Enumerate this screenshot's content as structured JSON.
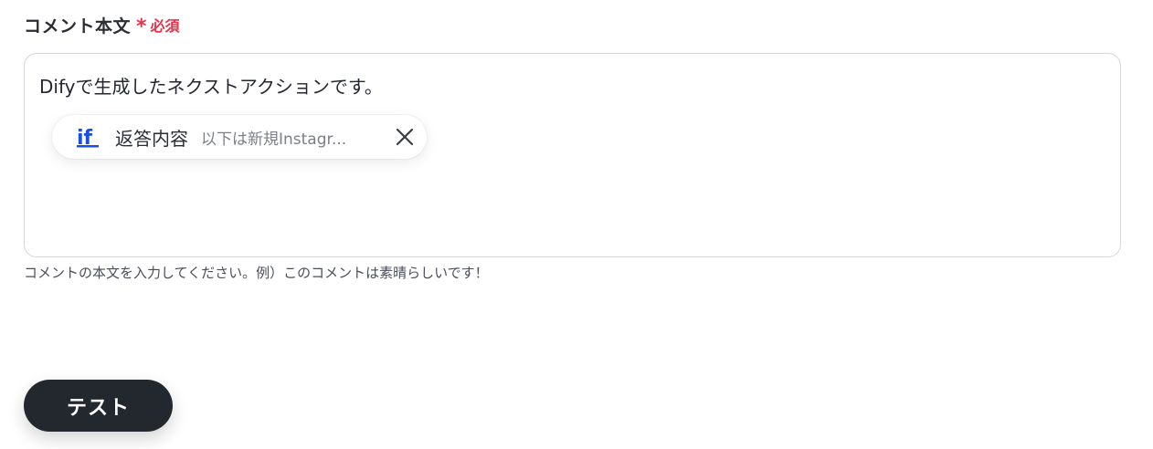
{
  "field": {
    "label": "コメント本文",
    "required_star": "*",
    "required_text": "必須"
  },
  "textarea": {
    "text": "Difyで生成したネクストアクションです。"
  },
  "chip": {
    "icon": "if-icon",
    "title": "返答内容",
    "value": "以下は新規Instagr...",
    "accent_color": "#1a4fe0"
  },
  "help": {
    "text": "コメントの本文を入力してください。例）このコメントは素晴らしいです！"
  },
  "actions": {
    "test_label": "テスト"
  }
}
